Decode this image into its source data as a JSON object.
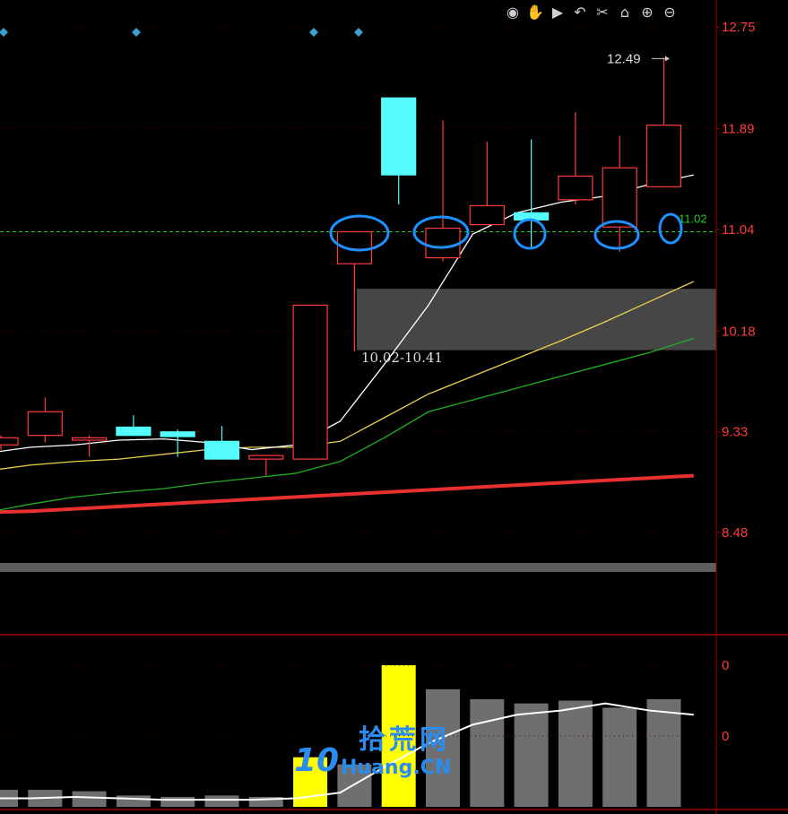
{
  "toolbar": {
    "icons": [
      "eye-icon",
      "hand-icon",
      "play-icon",
      "undo-icon",
      "scissors-icon",
      "lock-icon",
      "zoom-in-icon",
      "zoom-out-icon"
    ],
    "glyphs": [
      "◉",
      "✋",
      "▶",
      "↶",
      "✂",
      "⌂",
      "⊕",
      "⊖"
    ]
  },
  "chart_data": [
    {
      "type": "candlestick",
      "y_ticks": [
        "12.75",
        "11.89",
        "11.04",
        "10.18",
        "9.33",
        "8.48"
      ],
      "ylim": [
        7.85,
        12.85
      ],
      "high_label": "12.49",
      "last_label": "11.02",
      "reference_price": 11.02,
      "zone_label": "10.02-10.41",
      "zone": [
        10.02,
        10.41
      ],
      "candles": [
        {
          "o": 9.22,
          "h": 9.3,
          "l": 9.18,
          "c": 9.28
        },
        {
          "o": 9.3,
          "h": 9.62,
          "l": 9.24,
          "c": 9.5
        },
        {
          "o": 9.26,
          "h": 9.3,
          "l": 9.12,
          "c": 9.28
        },
        {
          "o": 9.37,
          "h": 9.47,
          "l": 9.3,
          "c": 9.3
        },
        {
          "o": 9.33,
          "h": 9.35,
          "l": 9.12,
          "c": 9.29
        },
        {
          "o": 9.25,
          "h": 9.38,
          "l": 9.14,
          "c": 9.1
        },
        {
          "o": 9.1,
          "h": 9.13,
          "l": 8.96,
          "c": 9.13
        },
        {
          "o": 9.1,
          "h": 10.4,
          "l": 9.1,
          "c": 10.4
        },
        {
          "o": 10.75,
          "h": 11.02,
          "l": 10.01,
          "c": 11.02
        },
        {
          "o": 12.15,
          "h": 12.15,
          "l": 11.25,
          "c": 11.5
        },
        {
          "o": 10.8,
          "h": 11.96,
          "l": 10.77,
          "c": 11.05
        },
        {
          "o": 11.08,
          "h": 11.78,
          "l": 11.08,
          "c": 11.24
        },
        {
          "o": 11.18,
          "h": 11.8,
          "l": 10.88,
          "c": 11.12
        },
        {
          "o": 11.29,
          "h": 12.03,
          "l": 11.25,
          "c": 11.49
        },
        {
          "o": 11.06,
          "h": 11.83,
          "l": 10.85,
          "c": 11.56
        },
        {
          "o": 11.4,
          "h": 12.49,
          "l": 11.4,
          "c": 11.92
        }
      ],
      "ma_white": [
        9.15,
        9.2,
        9.22,
        9.26,
        9.27,
        9.24,
        9.18,
        9.22,
        9.42,
        9.9,
        10.4,
        11.0,
        11.18,
        11.27,
        11.32,
        11.42,
        11.5
      ],
      "ma_yellow": [
        9.0,
        9.05,
        9.08,
        9.1,
        9.14,
        9.18,
        9.2,
        9.2,
        9.25,
        9.45,
        9.65,
        9.8,
        9.95,
        10.1,
        10.26,
        10.43,
        10.6
      ],
      "ma_green": [
        8.65,
        8.72,
        8.78,
        8.82,
        8.85,
        8.9,
        8.94,
        8.98,
        9.08,
        9.28,
        9.5,
        9.6,
        9.7,
        9.8,
        9.9,
        10.0,
        10.12
      ],
      "ma_red": [
        8.65,
        8.66,
        8.68,
        8.7,
        8.72,
        8.74,
        8.76,
        8.78,
        8.8,
        8.82,
        8.84,
        8.86,
        8.88,
        8.9,
        8.92,
        8.94,
        8.96
      ]
    },
    {
      "type": "bar",
      "y_ticks": [
        "0",
        "0"
      ],
      "values": [
        0.12,
        0.12,
        0.11,
        0.08,
        0.07,
        0.08,
        0.07,
        0.35,
        0.3,
        1.0,
        0.83,
        0.76,
        0.73,
        0.75,
        0.7,
        0.76
      ],
      "highlight": [
        false,
        false,
        false,
        false,
        false,
        false,
        false,
        true,
        false,
        true,
        false,
        false,
        false,
        false,
        false,
        false
      ],
      "line": [
        0.06,
        0.06,
        0.07,
        0.06,
        0.05,
        0.05,
        0.05,
        0.06,
        0.1,
        0.28,
        0.45,
        0.58,
        0.65,
        0.68,
        0.73,
        0.68,
        0.65
      ]
    }
  ],
  "watermark": {
    "cn": "拾荒网",
    "num": "10",
    "en": "Huang.CN"
  },
  "colors": {
    "up": "#ff3b3b",
    "down": "#54fcfc",
    "axis": "#a00000",
    "ref": "#22cc22",
    "circle": "#1e90ff",
    "zone": "#4a4a4a",
    "vol_hi": "#ffff00",
    "vol": "#6f6f6f"
  }
}
